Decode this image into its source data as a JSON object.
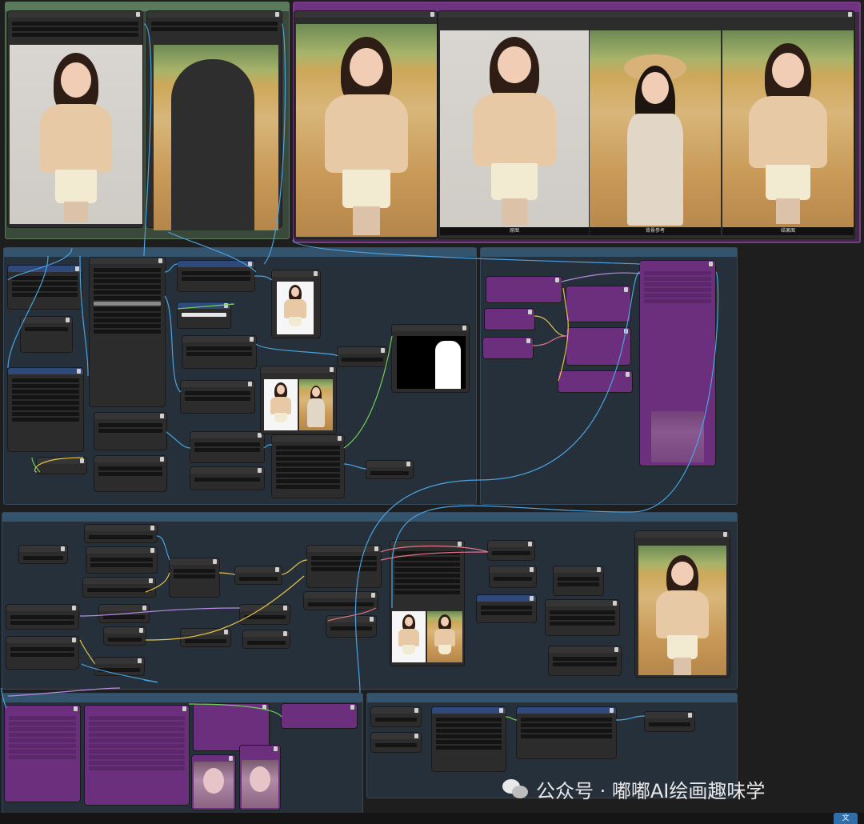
{
  "groups": {
    "top_left": "",
    "top_right": "",
    "image_processing": "",
    "repaint": "",
    "generate": "",
    "face_restore": "",
    "upscale": ""
  },
  "captions": {
    "original": "原图",
    "background_ref": "背景参考",
    "result": "结果图"
  },
  "watermark": {
    "text": "公众号 · 嘟嘟AI绘画趣味学"
  },
  "corner_button": {
    "label": "文"
  },
  "colors": {
    "wire_blue": "#4aa3df",
    "wire_yellow": "#e4c34a",
    "wire_green": "#6fcf5a",
    "wire_pink": "#e0738a",
    "wire_purple": "#b58be0",
    "group_purple": "#6e3480",
    "group_blue": "#34546e",
    "group_green": "#5b7a5b"
  },
  "icons": [
    "wechat-icon",
    "node-menu-icon"
  ]
}
